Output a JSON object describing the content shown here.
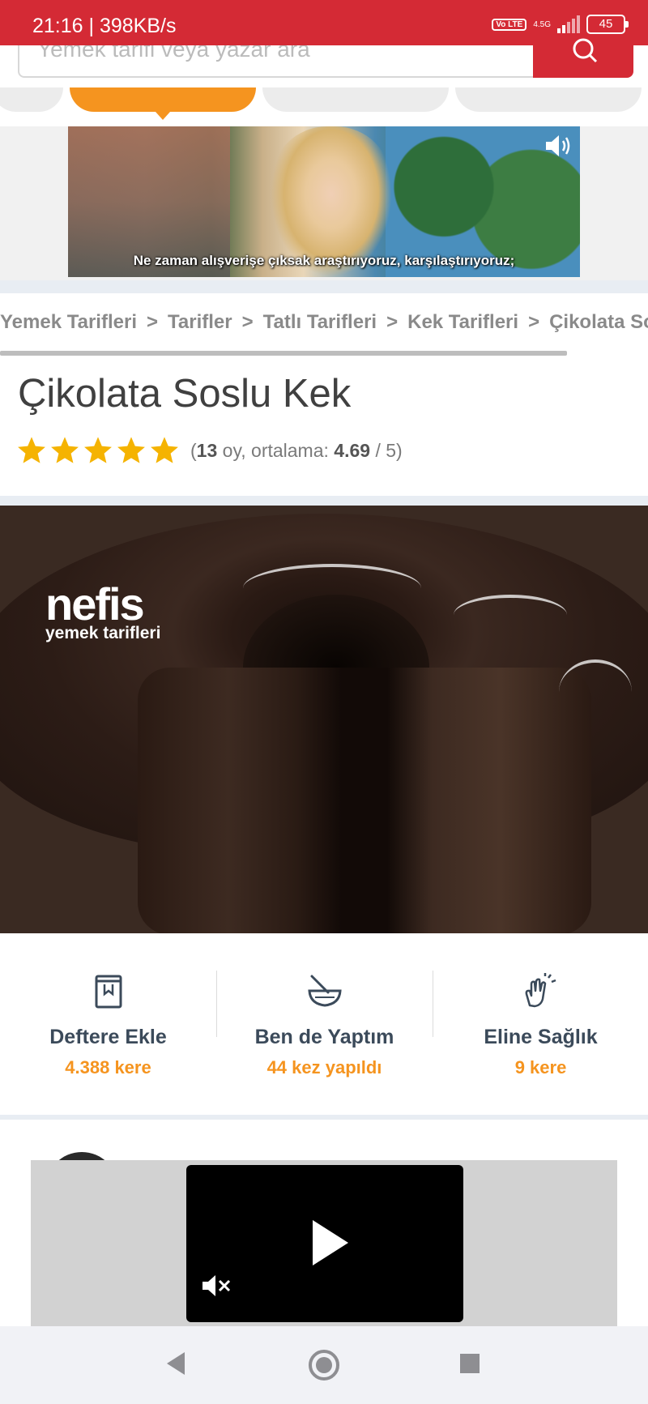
{
  "status_bar": {
    "time_speed": "21:16 | 398KB/s",
    "volte": "Vo LTE",
    "network": "4.5G",
    "battery": "45"
  },
  "search": {
    "placeholder": "Yemek tarifi veya yazar ara"
  },
  "ad": {
    "caption": "Ne zaman alışverişe çıksak araştırıyoruz, karşılaştırıyoruz;"
  },
  "breadcrumb": [
    "Yemek Tarifleri",
    "Tarifler",
    "Tatlı Tarifleri",
    "Kek Tarifleri",
    "Çikolata Soslu Kek"
  ],
  "breadcrumb_separator": ">",
  "recipe": {
    "title": "Çikolata Soslu Kek",
    "rating": {
      "stars": 5,
      "votes": "13",
      "votes_label": "oy, ortalama:",
      "average": "4.69",
      "max": "/ 5"
    },
    "watermark_brand": "nefis",
    "watermark_sub": "yemek tarifleri"
  },
  "actions": [
    {
      "label": "Deftere Ekle",
      "count": "4.388 kere",
      "icon": "notebook-icon"
    },
    {
      "label": "Ben de Yaptım",
      "count": "44 kez yapıldı",
      "icon": "mixing-bowl-icon"
    },
    {
      "label": "Eline Sağlık",
      "count": "9 kere",
      "icon": "clapping-hands-icon"
    }
  ],
  "colors": {
    "brand_red": "#d42a35",
    "accent_orange": "#f5941f",
    "star_yellow": "#f5b301"
  }
}
